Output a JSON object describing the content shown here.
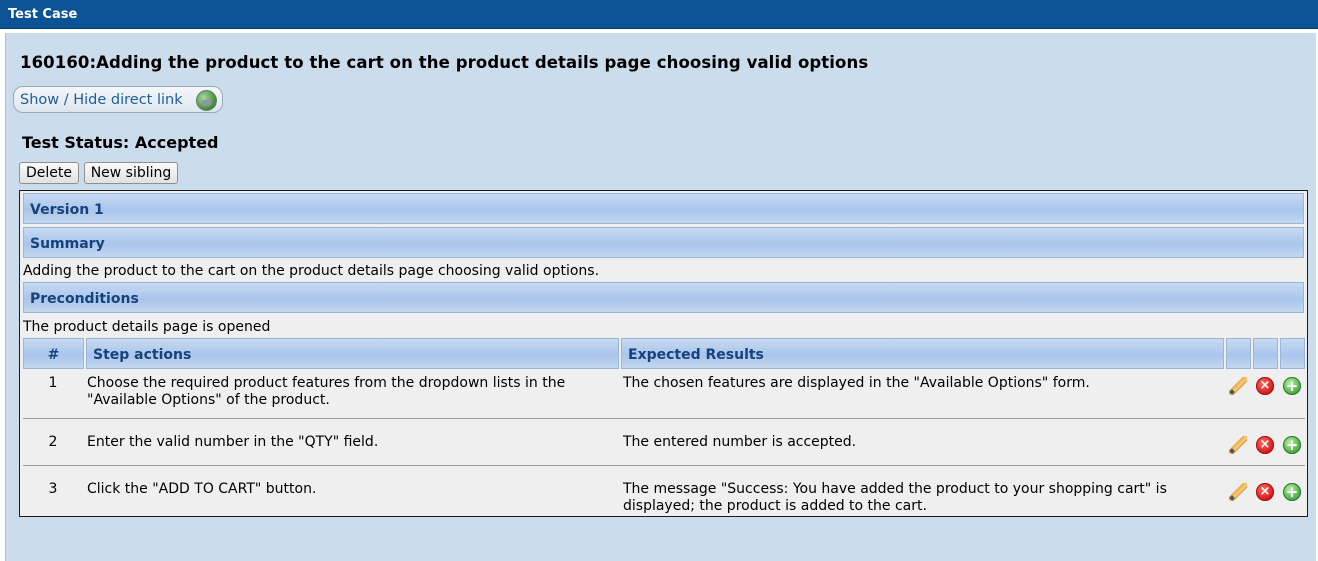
{
  "window": {
    "title": "Test Case"
  },
  "test_case": {
    "title": "160160:Adding the product to the cart on the product details page choosing valid options",
    "direct_link_label": "Show / Hide direct link",
    "status": "Test Status: Accepted"
  },
  "buttons": {
    "delete": "Delete",
    "new_sibling": "New sibling"
  },
  "sections": {
    "version": "Version 1",
    "summary_heading": "Summary",
    "summary_text": "Adding the product to the cart on the product details page choosing valid options.",
    "preconditions_heading": "Preconditions",
    "preconditions_text": "The product details page is opened"
  },
  "steps_table": {
    "columns": [
      "#",
      "Step actions",
      "Expected Results"
    ],
    "rows": [
      {
        "num": "1",
        "action": "Choose the required product features from the dropdown lists in the \"Available Options\" of the product.",
        "expected": "The chosen features are displayed in the \"Available Options\" form."
      },
      {
        "num": "2",
        "action": "Enter the valid number in the \"QTY\" field.",
        "expected": "The entered number is accepted."
      },
      {
        "num": "3",
        "action": "Click the \"ADD TO CART\" button.",
        "expected": "The message \"Success: You have added the product to your shopping cart\" is displayed; the product is added to the cart."
      }
    ],
    "row_icons": [
      "edit-pencil-icon",
      "delete-x-icon",
      "add-plus-icon"
    ]
  },
  "colors": {
    "titlebar": "#0b5394",
    "panel_bg": "#cbdcec",
    "section_header_text": "#17427c",
    "link_text": "#1d5d9b"
  }
}
